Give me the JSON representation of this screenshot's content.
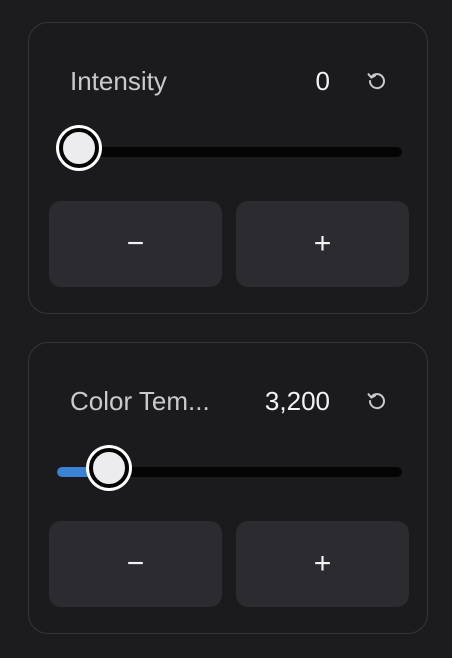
{
  "controls": [
    {
      "label": "Intensity",
      "value": "0",
      "fraction": 0.0,
      "decrement_label": "−",
      "increment_label": "+",
      "reset_icon": "reset-icon"
    },
    {
      "label": "Color Tem...",
      "value": "3,200",
      "fraction": 0.1,
      "decrement_label": "−",
      "increment_label": "+",
      "reset_icon": "reset-icon"
    }
  ],
  "colors": {
    "background": "#1c1c1f",
    "panel_border": "#34343a",
    "button_bg": "#2b2b30",
    "accent": "#3b82d6",
    "track": "#050506"
  }
}
